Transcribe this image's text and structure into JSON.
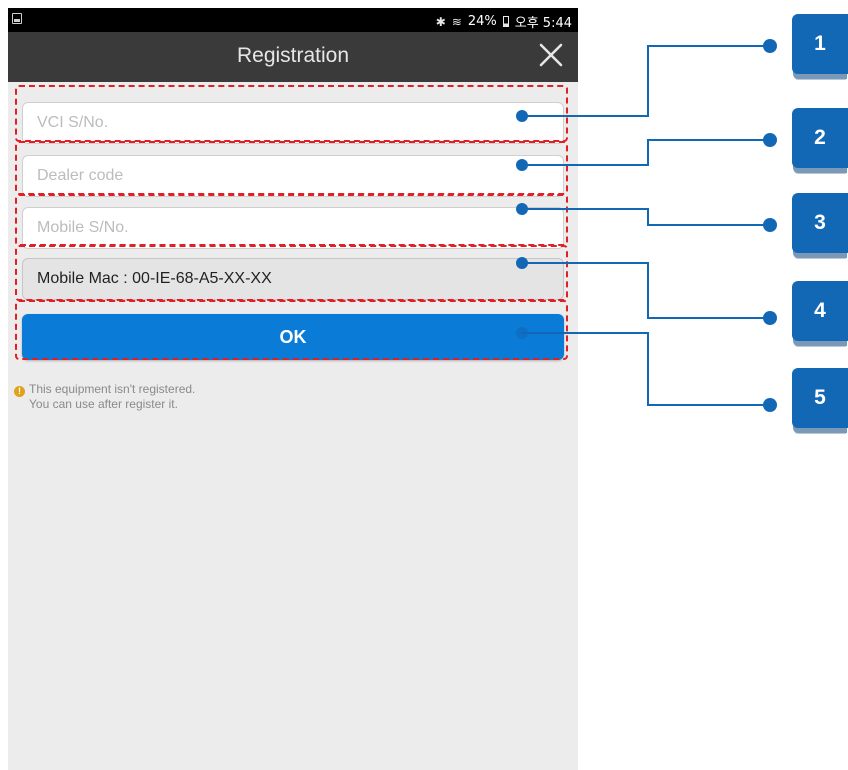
{
  "status_bar": {
    "battery": "24%",
    "time": "오후 5:44",
    "icons": [
      "image-icon",
      "bluetooth-icon",
      "wifi-icon",
      "battery-icon"
    ]
  },
  "header": {
    "title": "Registration",
    "close_icon": "close-icon"
  },
  "form": {
    "vci_placeholder": "VCI S/No.",
    "vci_value": "",
    "dealer_placeholder": "Dealer code",
    "dealer_value": "",
    "mobile_sn_placeholder": "Mobile S/No.",
    "mobile_sn_value": "",
    "mobile_mac": "Mobile Mac : 00-IE-68-A5-XX-XX",
    "ok_label": "OK"
  },
  "notice": {
    "line1": "This equipment isn't registered.",
    "line2": "You can use after register it."
  },
  "callouts": {
    "labels": [
      "1",
      "2",
      "3",
      "4",
      "5"
    ],
    "colors": {
      "badge": "#1368b6",
      "line": "#1368b6",
      "dash": "#e01f26"
    }
  },
  "colors": {
    "ok_button": "#0a7bd6",
    "title_bar": "#3a3a3a",
    "background": "#ececec"
  }
}
